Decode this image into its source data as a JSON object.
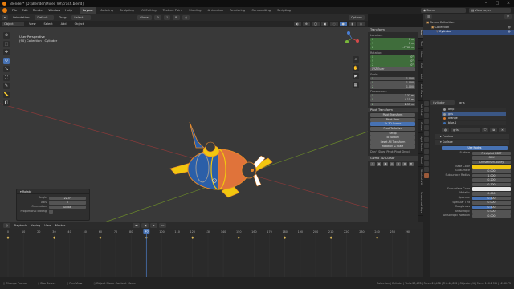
{
  "title_bar": {
    "title": "Blender* [D:\\Blender\\Mixed VR\\crash.blend]"
  },
  "menu": {
    "items": [
      "File",
      "Edit",
      "Render",
      "Window",
      "Help"
    ],
    "workspaces": [
      "Layout",
      "Modeling",
      "Sculpting",
      "UV Editing",
      "Texture Paint",
      "Shading",
      "Animation",
      "Rendering",
      "Compositing",
      "Scripting"
    ],
    "active_workspace": "Layout",
    "scene_label": "Scene",
    "view_layer_label": "View Layer"
  },
  "viewport_header": {
    "mode": "Object Mode",
    "menus": [
      "View",
      "Select",
      "Add",
      "Object"
    ],
    "orientation_label": "Orientation:",
    "orientation": "Default",
    "drag_label": "Drag:",
    "drag": "Select Box",
    "transform_orientation": "Global",
    "options": "Options"
  },
  "viewport": {
    "view_name": "User Perspective",
    "object_info": "(90) Collection | Cylinder",
    "tools": [
      "cursor-icon",
      "select-box-icon",
      "move-icon",
      "rotate-icon",
      "scale-icon",
      "transform-icon",
      "annotate-icon",
      "measure-icon",
      "add-cube-icon"
    ]
  },
  "operator_panel": {
    "title": "Rotate",
    "rows": [
      {
        "label": "Angle",
        "value": "22.5°"
      },
      {
        "label": "Axis",
        "value": "X"
      },
      {
        "label": "Orientation",
        "value": "Global"
      },
      {
        "label": "Proportional Editing",
        "value": ""
      }
    ]
  },
  "n_panel": {
    "transform_title": "Transform",
    "location_label": "Location:",
    "location": [
      {
        "axis": "X",
        "value": "0 m"
      },
      {
        "axis": "Y",
        "value": "0 m"
      },
      {
        "axis": "Z",
        "value": "1.7766 m"
      }
    ],
    "rotation_label": "Rotation:",
    "rotation": [
      {
        "axis": "X",
        "value": "0°"
      },
      {
        "axis": "Y",
        "value": "0°"
      },
      {
        "axis": "Z",
        "value": "0°"
      }
    ],
    "rotation_mode": "XYZ Euler",
    "scale_label": "Scale:",
    "scale": [
      {
        "axis": "X",
        "value": "1.000"
      },
      {
        "axis": "Y",
        "value": "1.000"
      },
      {
        "axis": "Z",
        "value": "1.000"
      }
    ],
    "dimensions_label": "Dimensions:",
    "dimensions": [
      {
        "axis": "X",
        "value": "7.37 m"
      },
      {
        "axis": "Y",
        "value": "4.15 m"
      },
      {
        "axis": "Z",
        "value": "2.55 m"
      }
    ],
    "pivot_title": "Pivot Transform",
    "pivot_buttons": [
      "Pivot Transform",
      "Pivot Drop",
      "To 3D Cursor",
      "Pivot To Active",
      "Setup",
      "To Bottom",
      "Reset All Transform",
      "Rotation & Scale"
    ],
    "pivot_check": "Don't Show Pivot(Pivot Drop)",
    "gizmo_title": "Gizmo 3D Cursor",
    "tabs": [
      "Item",
      "Tool",
      "View",
      "Edit",
      "Add",
      "Add Curve",
      "Edit Mesh",
      "Create",
      "Light Studio",
      "Decal",
      "Shortcut VUr",
      "Screencast Keys"
    ],
    "active_tab": "Item"
  },
  "outliner": {
    "rows": [
      {
        "label": "Scene Collection",
        "indent": 0,
        "selected": false
      },
      {
        "label": "Collection",
        "indent": 1,
        "selected": false
      },
      {
        "label": "Cylinder",
        "indent": 2,
        "selected": true
      }
    ]
  },
  "properties": {
    "object_name": "Cylinder",
    "material_name": "gris",
    "slots": [
      {
        "name": "amp",
        "color": "#9a9a9a",
        "selected": false
      },
      {
        "name": "gris",
        "color": "#9a9a9a",
        "selected": true
      },
      {
        "name": "orange",
        "color": "#d97a2b",
        "selected": false
      },
      {
        "name": "blue.0",
        "color": "#3d6fb3",
        "selected": false
      }
    ],
    "material_field": "gris",
    "sections": [
      "Preview",
      "Surface"
    ],
    "use_nodes": "Use Nodes",
    "surface_label": "Surface",
    "surface_value": "Principled BSDF",
    "distribution": "GGX",
    "subsurface_method": "Christensen-Burley",
    "inputs": [
      {
        "label": "Base Color",
        "value": "",
        "kind": "color",
        "color": "#f2c70f"
      },
      {
        "label": "Subsurface",
        "value": "0.000",
        "kind": "num"
      },
      {
        "label": "Subsurface Radius",
        "value": "1.000",
        "kind": "num"
      },
      {
        "label": "",
        "value": "0.200",
        "kind": "num"
      },
      {
        "label": "",
        "value": "0.100",
        "kind": "num"
      },
      {
        "label": "Subsurface Color",
        "value": "",
        "kind": "color",
        "color": "#e8e8e8"
      },
      {
        "label": "Metallic",
        "value": "0.000",
        "kind": "num"
      },
      {
        "label": "Specular",
        "value": "0.500",
        "kind": "bar"
      },
      {
        "label": "Specular Tint",
        "value": "0.000",
        "kind": "num"
      },
      {
        "label": "Roughness",
        "value": "0.500",
        "kind": "bar"
      },
      {
        "label": "Anisotropic",
        "value": "0.000",
        "kind": "num"
      },
      {
        "label": "Anisotropic Rotation",
        "value": "0.000",
        "kind": "num"
      }
    ]
  },
  "timeline": {
    "menus": [
      "Playback",
      "Keying",
      "View",
      "Marker"
    ],
    "frame_ticks": [
      0,
      10,
      20,
      30,
      40,
      50,
      60,
      70,
      80,
      90,
      100,
      110,
      120,
      130,
      140,
      150,
      160,
      170,
      180,
      190,
      200,
      210,
      220,
      230,
      240,
      250,
      260
    ],
    "current_frame": 90,
    "keyframes": [
      0,
      30,
      60,
      90,
      120,
      150,
      180,
      210,
      240
    ]
  },
  "status_bar": {
    "items": [
      "Change Frame",
      "Box Select",
      "Pan View",
      "Object Mode Context Menu"
    ],
    "right": "Collection | Cylinder | Verts:23,478 | Faces:23,458 | Tris:46,832 | Objects:1/4 | Mem: 110.2 MB | v2.80.75"
  },
  "colors": {
    "accent": "#4772b3",
    "active_tool": "#4772b3",
    "frame_indicator": "#4772b3",
    "keyframe": "#e6c15a"
  }
}
